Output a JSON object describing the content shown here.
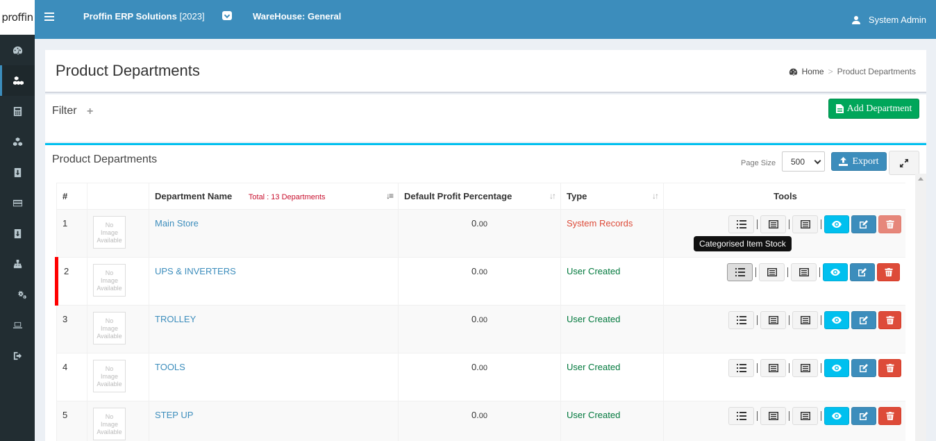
{
  "logo": {
    "text": "proffin"
  },
  "sidebar": {
    "items": [
      {
        "name": "dashboard-icon",
        "active": false
      },
      {
        "name": "departments-icon",
        "active": true
      },
      {
        "name": "calculator-icon",
        "active": false
      },
      {
        "name": "cubes-icon",
        "active": false
      },
      {
        "name": "download-icon",
        "active": false
      },
      {
        "name": "credit-card-icon",
        "active": false
      },
      {
        "name": "download-icon",
        "active": false
      },
      {
        "name": "sitemap-icon",
        "active": false
      },
      {
        "name": "gears-icon",
        "active": false
      },
      {
        "name": "laptop-icon",
        "active": false
      },
      {
        "name": "sign-out-icon",
        "active": false
      }
    ]
  },
  "header": {
    "app_name": "Proffin ERP Solutions",
    "year": "[2023]",
    "warehouse": "WareHouse: General",
    "user": "System Admin"
  },
  "page": {
    "title": "Product Departments",
    "breadcrumb_home": "Home",
    "breadcrumb_sep": ">",
    "breadcrumb_current": "Product Departments"
  },
  "filter": {
    "title": "Filter",
    "plus": "+",
    "add_label": "Add Department"
  },
  "list": {
    "title": "Product Departments",
    "page_size_label": "Page Size",
    "page_size": "500",
    "export_label": "Export"
  },
  "table": {
    "headers": {
      "index": "#",
      "image": "",
      "name": "Department Name",
      "total": "Total : 13 Departments",
      "profit": "Default Profit Percentage",
      "type": "Type",
      "tools": "Tools"
    },
    "noimage_line1": "No",
    "noimage_line2": "Image",
    "noimage_line3": "Available",
    "rows": [
      {
        "index": "1",
        "name": "Main Store",
        "profit_int": "0.",
        "profit_dec": "00",
        "type": "System Records"
      },
      {
        "index": "2",
        "name": "UPS & INVERTERS",
        "profit_int": "0.",
        "profit_dec": "00",
        "type": "User Created"
      },
      {
        "index": "3",
        "name": "TROLLEY",
        "profit_int": "0.",
        "profit_dec": "00",
        "type": "User Created"
      },
      {
        "index": "4",
        "name": "TOOLS",
        "profit_int": "0.",
        "profit_dec": "00",
        "type": "User Created"
      },
      {
        "index": "5",
        "name": "STEP UP",
        "profit_int": "0.",
        "profit_dec": "00",
        "type": "User Created"
      }
    ]
  },
  "tooltip": {
    "text": "Categorised Item Stock"
  },
  "colors": {
    "header": "#3c8dbc",
    "sidebar": "#222d32",
    "success": "#00a65a",
    "info": "#00c0ef",
    "danger": "#dd4b39",
    "highlight": "#ff0000"
  }
}
